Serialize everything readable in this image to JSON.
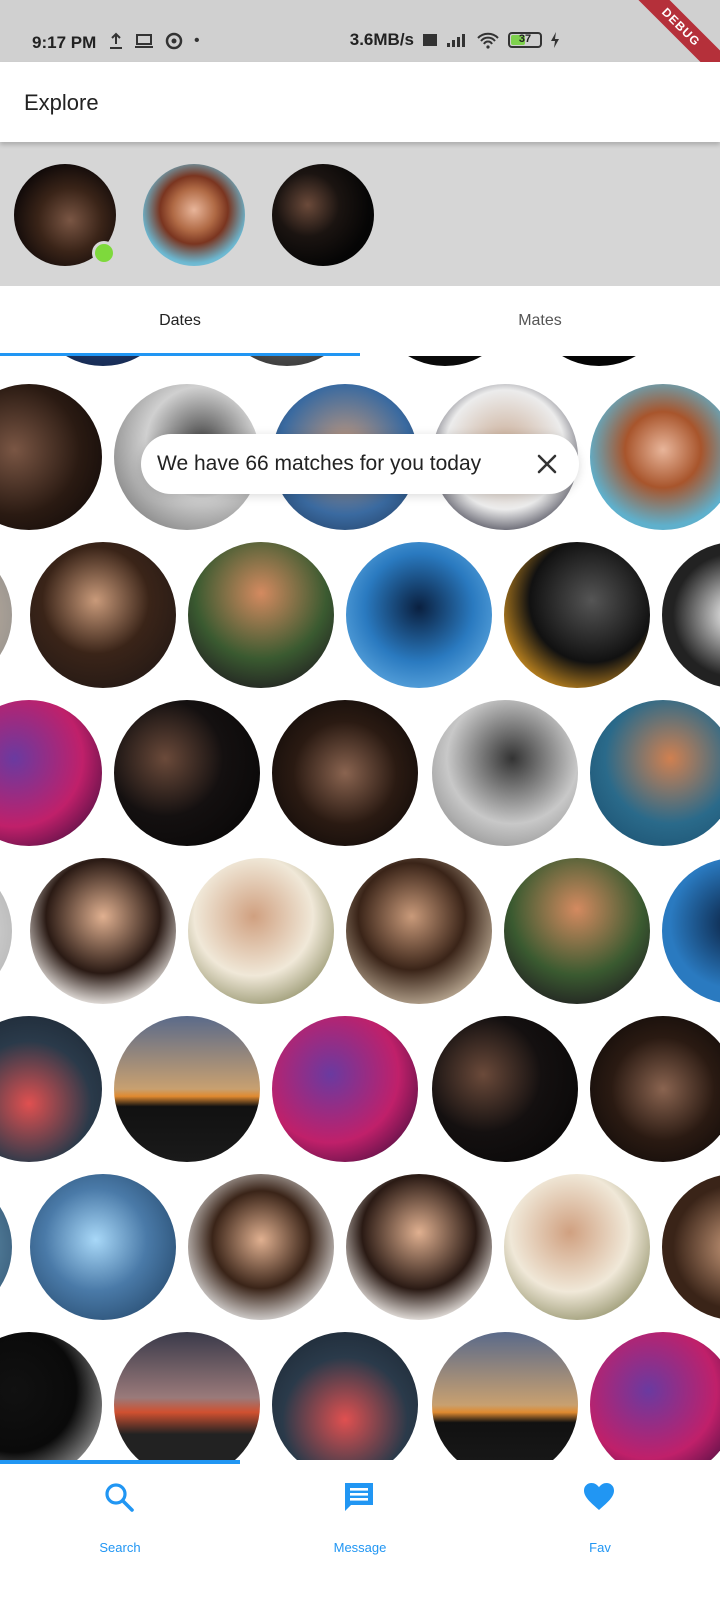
{
  "status_bar": {
    "time": "9:17 PM",
    "network_speed": "3.6MB/s",
    "battery": "37",
    "debug_label": "DEBUG"
  },
  "appbar": {
    "title": "Explore"
  },
  "tabs": [
    {
      "label": "Dates",
      "selected": true
    },
    {
      "label": "Mates",
      "selected": false
    }
  ],
  "toast": {
    "message": "We have 66 matches for you today"
  },
  "bottom_nav": [
    {
      "label": "Search",
      "icon": "search-icon",
      "selected": true
    },
    {
      "label": "Message",
      "icon": "message-icon",
      "selected": false
    },
    {
      "label": "Fav",
      "icon": "heart-icon",
      "selected": false
    }
  ],
  "colors": {
    "accent": "#2196f3",
    "online": "#7ed93c",
    "stories_bg": "#d6d6d6"
  }
}
